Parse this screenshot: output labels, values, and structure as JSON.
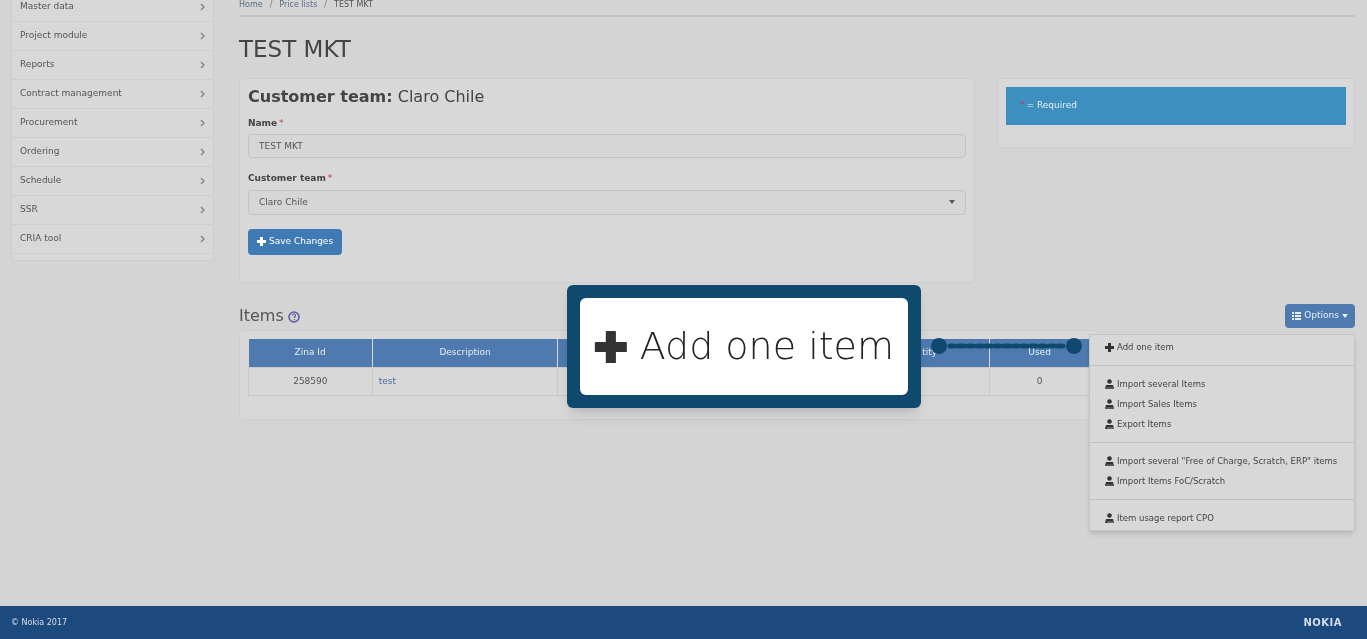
{
  "sidebar": {
    "items": [
      {
        "label": "Master data"
      },
      {
        "label": "Project module"
      },
      {
        "label": "Reports"
      },
      {
        "label": "Contract management"
      },
      {
        "label": "Procurement"
      },
      {
        "label": "Ordering"
      },
      {
        "label": "Schedule"
      },
      {
        "label": "SSR"
      },
      {
        "label": "CRIA tool"
      }
    ]
  },
  "breadcrumb": [
    {
      "kind": "link",
      "label": "Home"
    },
    {
      "kind": "separator",
      "label": "/"
    },
    {
      "kind": "link",
      "label": "Price lists"
    },
    {
      "kind": "separator",
      "label": "/"
    },
    {
      "kind": "current",
      "label": "TEST MKT"
    }
  ],
  "page_title": "TEST MKT",
  "form": {
    "heading_bold": "Customer team:",
    "heading_value": "Claro Chile",
    "name_label": "Name",
    "name_required": "*",
    "team_required": "*",
    "name_value": "TEST MKT",
    "team_label": "Customer team",
    "team_value": "Claro Chile",
    "save_button": "Save Changes"
  },
  "required_mark": "*",
  "required_note": "= Required",
  "items_section": {
    "title": "Items",
    "options_button": "Options",
    "table": {
      "columns": [
        {
          "label": "Zina Id"
        },
        {
          "label": "Description"
        },
        {},
        {
          "label": "tity"
        },
        {
          "label": "Used"
        }
      ],
      "rows": [
        [
          "258590",
          "test",
          "",
          "",
          "0"
        ]
      ]
    }
  },
  "options_menu": {
    "groups": [
      [
        {
          "kind": "add",
          "label": "Add one item"
        }
      ],
      [
        {
          "kind": "import",
          "label": "Import several Items"
        },
        {
          "kind": "import",
          "label": "Import Sales Items"
        },
        {
          "kind": "export",
          "label": "Export Items"
        }
      ],
      [
        {
          "kind": "import",
          "label": "Import several \"Free of Charge, Scratch, ERP\" items"
        },
        {
          "kind": "import",
          "label": "Import Items FoC/Scratch"
        }
      ],
      [
        {
          "kind": "export",
          "label": "Item usage report CPO"
        }
      ]
    ]
  },
  "callout": {
    "label": "Add one item"
  },
  "footer": {
    "copyright": "© Nokia 2017",
    "brand": "NOKIA"
  }
}
